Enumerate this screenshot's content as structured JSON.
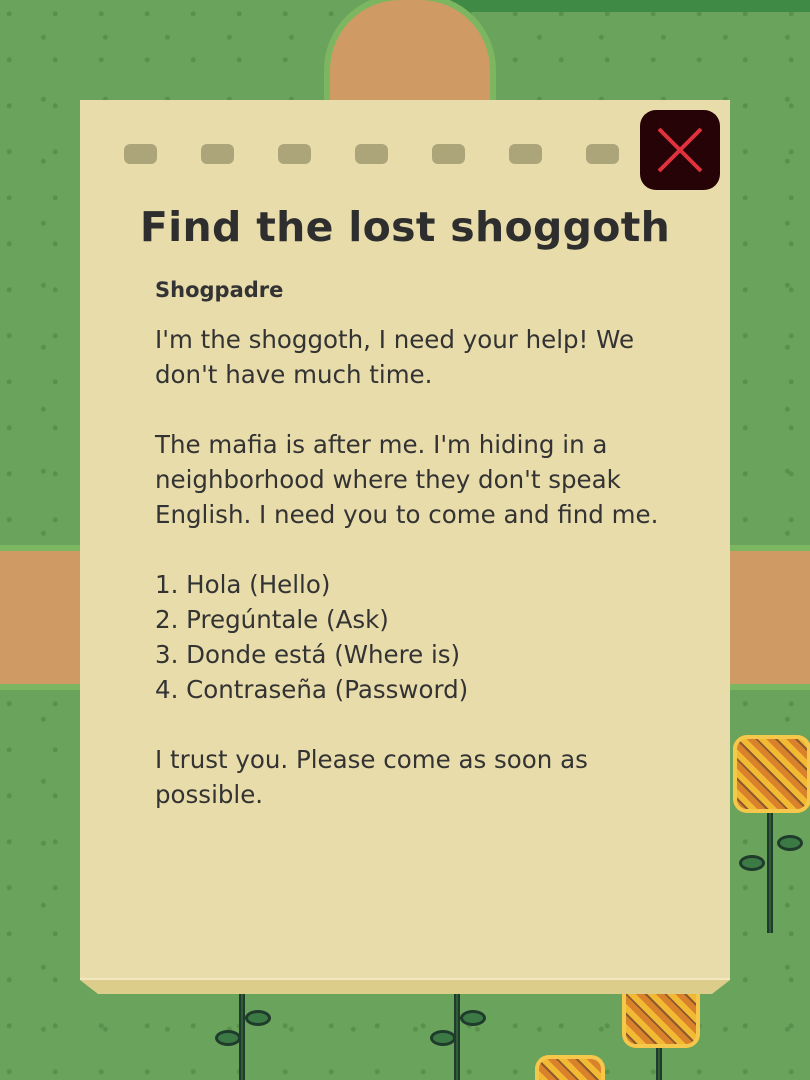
{
  "dialog": {
    "title": "Find the lost shoggoth",
    "sender": "Shogpadre",
    "message": "I'm the shoggoth, I need your help! We don't have much time.\n\nThe mafia is after me. I'm hiding in a neighborhood where they don't speak English. I need you to come and find me.\n\n1. Hola (Hello)\n2. Pregúntale (Ask)\n3. Donde está (Where is)\n4. Contraseña (Password)\n\nI trust you. Please come as soon as possible.",
    "close_icon": "close-x-icon"
  },
  "colors": {
    "paper": "#e8dcab",
    "close_button_bg": "#260306",
    "close_x": "#e0323c",
    "grass": "#6aa35b",
    "dirt_path": "#cf9a63"
  }
}
